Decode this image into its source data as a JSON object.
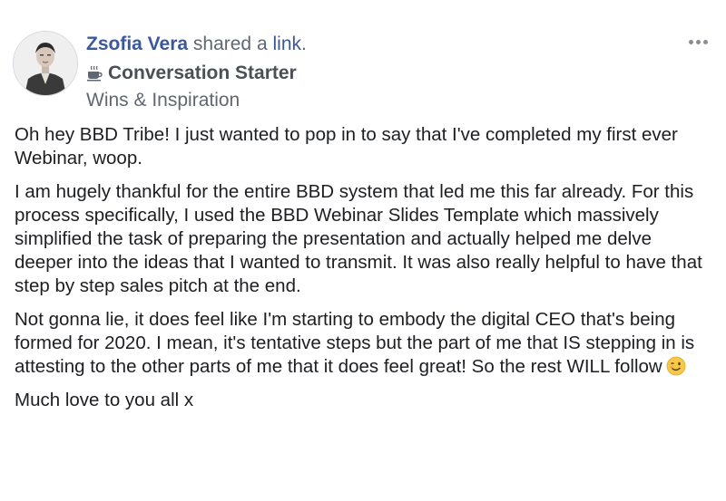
{
  "post": {
    "author": "Zsofia Vera",
    "action": "shared a",
    "link_text": "link",
    "topic_icon": "coffee-cup-icon",
    "topic": "Conversation Starter",
    "group": "Wins & Inspiration",
    "paragraphs": [
      "Oh hey BBD Tribe! I just wanted to pop in to say that I've completed my first ever Webinar, woop.",
      "I am hugely thankful for the entire BBD system that led me this far already. For this process specifically, I used the BBD Webinar Slides Template which massively simplified the task of preparing the presentation and actually helped me delve deeper into the ideas that I wanted to transmit. It was also really helpful to have that step by step sales pitch at the end.",
      "Not gonna lie, it does feel like I'm starting to embody the digital CEO that's being formed for 2020. I mean, it's tentative steps but the part of me that IS stepping in is attesting to the other parts of me that it does feel great! So the rest WILL follow",
      "Much love to you all x"
    ],
    "emoji": "winking-smile-emoji"
  }
}
